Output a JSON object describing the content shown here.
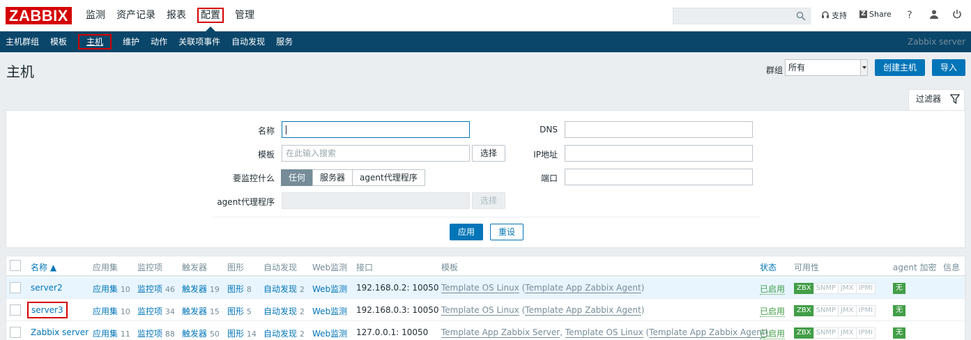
{
  "logo": "ZABBIX",
  "top_menu": [
    {
      "label": "监测",
      "active": false
    },
    {
      "label": "资产记录",
      "active": false
    },
    {
      "label": "报表",
      "active": false
    },
    {
      "label": "配置",
      "active": true
    },
    {
      "label": "管理",
      "active": false
    }
  ],
  "top_links": {
    "support": "支持",
    "share": "Share",
    "help": "?"
  },
  "sub_menu": [
    {
      "label": "主机群组",
      "active": false
    },
    {
      "label": "模板",
      "active": false
    },
    {
      "label": "主机",
      "active": true
    },
    {
      "label": "维护",
      "active": false
    },
    {
      "label": "动作",
      "active": false
    },
    {
      "label": "关联项事件",
      "active": false
    },
    {
      "label": "自动发现",
      "active": false
    },
    {
      "label": "服务",
      "active": false
    }
  ],
  "server_name": "Zabbix server",
  "page_title": "主机",
  "group": {
    "label": "群组",
    "value": "所有"
  },
  "buttons": {
    "create_host": "创建主机",
    "import": "导入"
  },
  "filter": {
    "tab_label": "过滤器",
    "name_label": "名称",
    "name_value": "",
    "template_label": "模板",
    "template_placeholder": "在此输入搜索",
    "select_label": "选择",
    "monitor_label": "要监控什么",
    "monitor_options": [
      "任何",
      "服务器",
      "agent代理程序"
    ],
    "monitor_selected": "任何",
    "proxy_label": "agent代理程序",
    "proxy_select_label": "选择",
    "dns_label": "DNS",
    "ip_label": "IP地址",
    "port_label": "端口",
    "apply_label": "应用",
    "reset_label": "重设"
  },
  "table": {
    "headers": [
      "名称 ▲",
      "应用集",
      "监控项",
      "触发器",
      "图形",
      "自动发现",
      "Web监测",
      "接口",
      "模板",
      "状态",
      "可用性",
      "agent 加密",
      "信息"
    ],
    "rows": [
      {
        "name": "server2",
        "apps": "应用集",
        "apps_count": "10",
        "items": "监控项",
        "items_count": "46",
        "triggers": "触发器",
        "triggers_count": "19",
        "graphs": "图形",
        "graphs_count": "8",
        "discovery": "自动发现",
        "discovery_count": "2",
        "web": "Web监测",
        "interface": "192.168.0.2: 10050",
        "templates": [
          "Template OS Linux"
        ],
        "templates_parent": "Template App Zabbix Agent",
        "status": "已启用",
        "availability": [
          "ZBX",
          "SNMP",
          "JMX",
          "IPMI"
        ],
        "encryption": "无"
      },
      {
        "name": "server3",
        "apps": "应用集",
        "apps_count": "10",
        "items": "监控项",
        "items_count": "34",
        "triggers": "触发器",
        "triggers_count": "15",
        "graphs": "图形",
        "graphs_count": "5",
        "discovery": "自动发现",
        "discovery_count": "2",
        "web": "Web监测",
        "interface": "192.168.0.3: 10050",
        "templates": [
          "Template OS Linux"
        ],
        "templates_parent": "Template App Zabbix Agent",
        "status": "已启用",
        "availability": [
          "ZBX",
          "SNMP",
          "JMX",
          "IPMI"
        ],
        "encryption": "无"
      },
      {
        "name": "Zabbix server",
        "apps": "应用集",
        "apps_count": "11",
        "items": "监控项",
        "items_count": "88",
        "triggers": "触发器",
        "triggers_count": "50",
        "graphs": "图形",
        "graphs_count": "14",
        "discovery": "自动发现",
        "discovery_count": "2",
        "web": "Web监测",
        "interface": "127.0.0.1: 10050",
        "templates": [
          "Template App Zabbix Server",
          "Template OS Linux"
        ],
        "templates_parent": "Template App Zabbix Agent",
        "status": "已启用",
        "availability": [
          "ZBX",
          "SNMP",
          "JMX",
          "IPMI"
        ],
        "encryption": "无"
      }
    ]
  },
  "colors": {
    "brand": "#d40000",
    "subnav": "#0a466a",
    "link": "#0275b8",
    "enabled": "#429e47"
  }
}
